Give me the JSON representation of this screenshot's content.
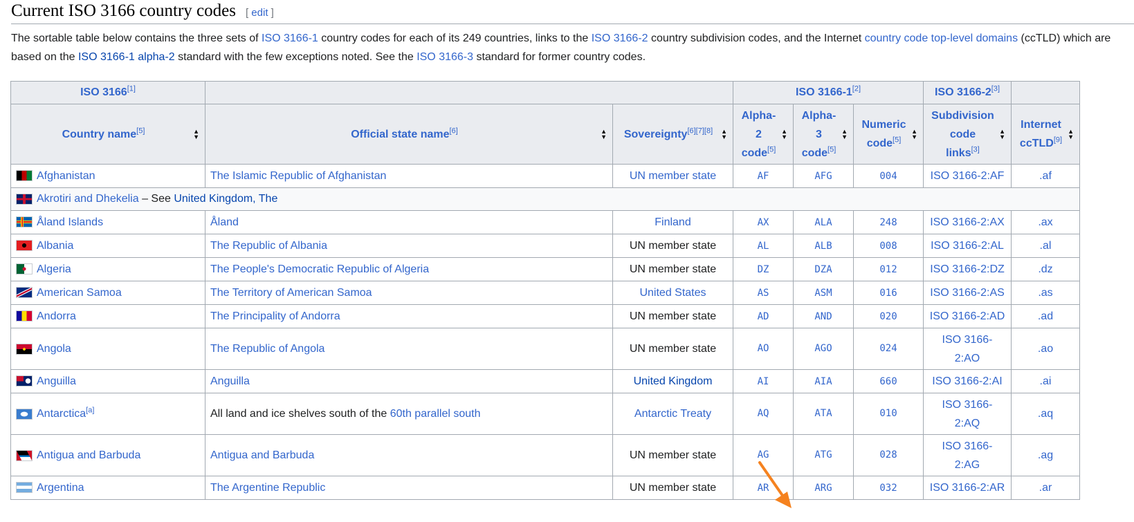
{
  "heading": {
    "title": "Current ISO 3166 country codes",
    "edit_open": "[ ",
    "edit": "edit",
    "edit_close": " ]"
  },
  "intro": {
    "t1": "The sortable table below contains the three sets of ",
    "l1": "ISO 3166-1",
    "t2": " country codes for each of its 249 countries, links to the ",
    "l2": "ISO 3166-2",
    "t3": " country subdivision codes, and the Internet ",
    "l3": "country code top-level domains",
    "t4": " (ccTLD) which are based on the ",
    "l4": "ISO 3166-1 alpha-2",
    "t5": " standard with the few exceptions noted. See the ",
    "l5": "ISO 3166-3",
    "t6": " standard for former country codes."
  },
  "table": {
    "group_headers": {
      "iso3166": "ISO 3166",
      "iso3166_ref": "[1]",
      "iso3166_1": "ISO 3166-1",
      "iso3166_1_ref": "[2]",
      "iso3166_2": "ISO 3166-2",
      "iso3166_2_ref": "[3]"
    },
    "columns": {
      "country": "Country name",
      "country_ref": "[5]",
      "official": "Official state name",
      "official_ref": "[6]",
      "sovereignty": "Sovereignty",
      "sovereignty_ref": "[6][7][8]",
      "alpha2_a": "Alpha-",
      "alpha2_b": "2",
      "alpha2_c": "code",
      "alpha2_ref": "[5]",
      "alpha3_a": "Alpha-",
      "alpha3_b": "3",
      "alpha3_c": "code",
      "alpha3_ref": "[5]",
      "numeric_a": "Numeric",
      "numeric_b": "code",
      "numeric_ref": "[5]",
      "subdiv_a": "Subdivision",
      "subdiv_b": "code",
      "subdiv_c": "links",
      "subdiv_ref": "[3]",
      "tld_a": "Internet",
      "tld_b": "ccTLD",
      "tld_ref": "[9]"
    },
    "akrotiri": {
      "name": "Akrotiri and Dhekelia",
      "sep": " – See ",
      "link": "United Kingdom, The"
    },
    "rows": [
      {
        "country": "Afghanistan",
        "official": "The Islamic Republic of Afghanistan",
        "sov": "UN member state",
        "a2": "AF",
        "a3": "AFG",
        "num": "004",
        "sub": "ISO 3166-2:AF",
        "tld": ".af"
      },
      {
        "country": "Åland Islands",
        "official": "Åland",
        "sov": "Finland",
        "a2": "AX",
        "a3": "ALA",
        "num": "248",
        "sub": "ISO 3166-2:AX",
        "tld": ".ax"
      },
      {
        "country": "Albania",
        "official": "The Republic of Albania",
        "sov": "UN member state",
        "a2": "AL",
        "a3": "ALB",
        "num": "008",
        "sub": "ISO 3166-2:AL",
        "tld": ".al"
      },
      {
        "country": "Algeria",
        "official": "The People's Democratic Republic of Algeria",
        "sov": "UN member state",
        "a2": "DZ",
        "a3": "DZA",
        "num": "012",
        "sub": "ISO 3166-2:DZ",
        "tld": ".dz"
      },
      {
        "country": "American Samoa",
        "official": "The Territory of American Samoa",
        "sov": "United States",
        "a2": "AS",
        "a3": "ASM",
        "num": "016",
        "sub": "ISO 3166-2:AS",
        "tld": ".as"
      },
      {
        "country": "Andorra",
        "official": "The Principality of Andorra",
        "sov": "UN member state",
        "a2": "AD",
        "a3": "AND",
        "num": "020",
        "sub": "ISO 3166-2:AD",
        "tld": ".ad"
      },
      {
        "country": "Angola",
        "official": "The Republic of Angola",
        "sov": "UN member state",
        "a2": "AO",
        "a3": "AGO",
        "num": "024",
        "sub_a": "ISO 3166-",
        "sub_b": "2:AO",
        "tld": ".ao"
      },
      {
        "country": "Anguilla",
        "official": "Anguilla",
        "sov": "United Kingdom",
        "a2": "AI",
        "a3": "AIA",
        "num": "660",
        "sub": "ISO 3166-2:AI",
        "tld": ".ai"
      },
      {
        "country": "Antarctica",
        "country_ref": "[a]",
        "official_pre": "All land and ice shelves south of the ",
        "official_link": "60th parallel south",
        "sov": "Antarctic Treaty",
        "a2": "AQ",
        "a3": "ATA",
        "num": "010",
        "sub_a": "ISO 3166-",
        "sub_b": "2:AQ",
        "tld": ".aq"
      },
      {
        "country": "Antigua and Barbuda",
        "official": "Antigua and Barbuda",
        "sov": "UN member state",
        "a2": "AG",
        "a3": "ATG",
        "num": "028",
        "sub_a": "ISO 3166-",
        "sub_b": "2:AG",
        "tld": ".ag"
      },
      {
        "country": "Argentina",
        "official": "The Argentine Republic",
        "sov": "UN member state",
        "a2": "AR",
        "a3": "ARG",
        "num": "032",
        "sub": "ISO 3166-2:AR",
        "tld": ".ar"
      }
    ]
  },
  "colors": {
    "link": "#3366cc",
    "header_bg": "#eaecf0",
    "border": "#a2a9b1",
    "annotation_arrow": "#f5821f"
  }
}
